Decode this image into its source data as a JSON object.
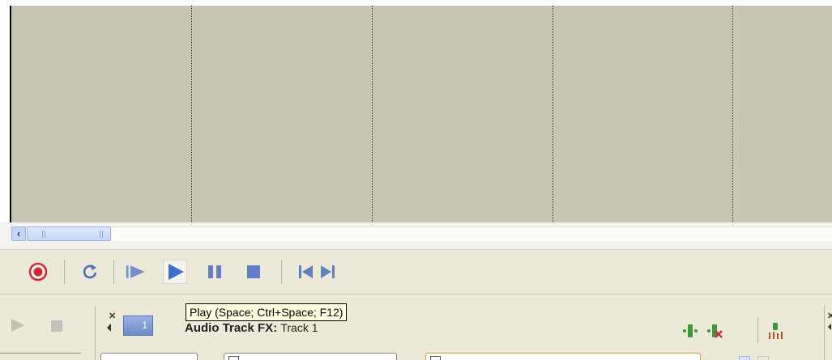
{
  "tooltip": {
    "text": "Play (Space; Ctrl+Space; F12)"
  },
  "fx_panel": {
    "track_number": "1",
    "title": "Audio Track FX:",
    "subtitle": "Track 1"
  },
  "transport": {
    "buttons": [
      {
        "name": "record",
        "icon": "record-icon"
      },
      {
        "name": "loop",
        "icon": "loop-icon"
      },
      {
        "name": "play-from-start",
        "icon": "play-from-start-icon"
      },
      {
        "name": "play",
        "icon": "play-icon"
      },
      {
        "name": "pause",
        "icon": "pause-icon"
      },
      {
        "name": "stop",
        "icon": "stop-icon"
      },
      {
        "name": "go-to-start",
        "icon": "go-to-start-icon"
      },
      {
        "name": "go-to-end",
        "icon": "go-to-end-icon"
      }
    ]
  },
  "colors": {
    "timeline_bg": "#c9c6b6",
    "panel_bg": "#ece9d8",
    "accent_blue": "#3d6fc4",
    "record_red": "#d9232e",
    "tooltip_bg": "#ffffe1"
  }
}
